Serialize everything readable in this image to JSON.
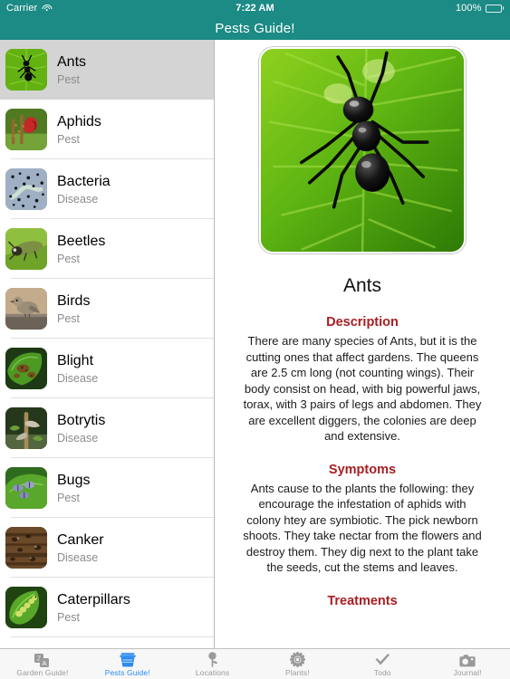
{
  "status_bar": {
    "carrier": "Carrier",
    "wifi_icon": "wifi-icon",
    "time": "7:22 AM",
    "battery_percent": "100%",
    "battery_icon": "battery-full-icon"
  },
  "navbar": {
    "title": "Pests Guide!",
    "background_color": "#1c8a85",
    "text_color": "#ffffff"
  },
  "sidebar": {
    "selected_index": 0,
    "items": [
      {
        "title": "Ants",
        "subtitle": "Pest",
        "thumb": "ant-on-leaf-thumb"
      },
      {
        "title": "Aphids",
        "subtitle": "Pest",
        "thumb": "aphids-on-flower-thumb"
      },
      {
        "title": "Bacteria",
        "subtitle": "Disease",
        "thumb": "bacteria-micrograph-thumb"
      },
      {
        "title": "Beetles",
        "subtitle": "Pest",
        "thumb": "beetle-on-leaf-thumb"
      },
      {
        "title": "Birds",
        "subtitle": "Pest",
        "thumb": "bird-on-ground-thumb"
      },
      {
        "title": "Blight",
        "subtitle": "Disease",
        "thumb": "blighted-leaf-thumb"
      },
      {
        "title": "Botrytis",
        "subtitle": "Disease",
        "thumb": "botrytis-stem-thumb"
      },
      {
        "title": "Bugs",
        "subtitle": "Pest",
        "thumb": "bugs-on-leaf-thumb"
      },
      {
        "title": "Canker",
        "subtitle": "Disease",
        "thumb": "canker-bark-thumb"
      },
      {
        "title": "Caterpillars",
        "subtitle": "Pest",
        "thumb": "caterpillar-on-leaf-thumb"
      }
    ]
  },
  "detail": {
    "hero_image": "ant-on-green-leaf-photo",
    "title": "Ants",
    "sections": [
      {
        "heading": "Description",
        "body": "There are many species of Ants, but it is the cutting ones that affect gardens. The queens are 2.5 cm long (not counting wings). Their body consist on head, with big powerful jaws, torax, with 3 pairs of legs and abdomen. They are excellent diggers, the colonies are deep and extensive."
      },
      {
        "heading": "Symptoms",
        "body": "Ants cause to the plants the following: they encourage the infestation of aphids with colony htey are symbiotic. The pick newborn shoots. They take nectar from the flowers and destroy them. They dig next to the plant take the seeds, cut the stems and leaves."
      },
      {
        "heading": "Treatments",
        "body": ""
      }
    ],
    "heading_color": "#a81e22"
  },
  "tabbar": {
    "active_index": 1,
    "active_color": "#2b8bf2",
    "inactive_color": "#9a9a9a",
    "tabs": [
      {
        "label": "Garden Guide!",
        "icon": "translate-icon"
      },
      {
        "label": "Pests Guide!",
        "icon": "crate-box-icon"
      },
      {
        "label": "Locations",
        "icon": "map-pin-icon"
      },
      {
        "label": "Plants!",
        "icon": "flower-icon"
      },
      {
        "label": "Todo",
        "icon": "checkmark-icon"
      },
      {
        "label": "Journal!",
        "icon": "camera-icon"
      }
    ]
  }
}
